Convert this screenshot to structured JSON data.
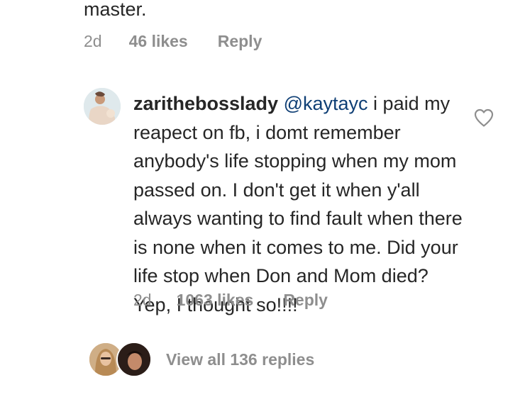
{
  "previous_comment": {
    "text_tail": "master.",
    "time": "2d",
    "likes": "46 likes",
    "reply_label": "Reply"
  },
  "comment": {
    "username": "zarithebosslady",
    "mention": "@kaytayc",
    "text": " i paid my reapect on fb, i domt remember anybody's life stopping when my mom passed on. I don't get it when y'all always wanting to find fault when there is none when it comes to me. Did your life stop when Don and Mom died? Yep, I thought so!!!!",
    "time": "2d",
    "likes": "1063 likes",
    "reply_label": "Reply",
    "like_icon": "heart-outline-icon"
  },
  "replies": {
    "view_label": "View all 136 replies"
  },
  "colors": {
    "text": "#262626",
    "meta": "#8e8e8e",
    "mention": "#0f3f75"
  }
}
